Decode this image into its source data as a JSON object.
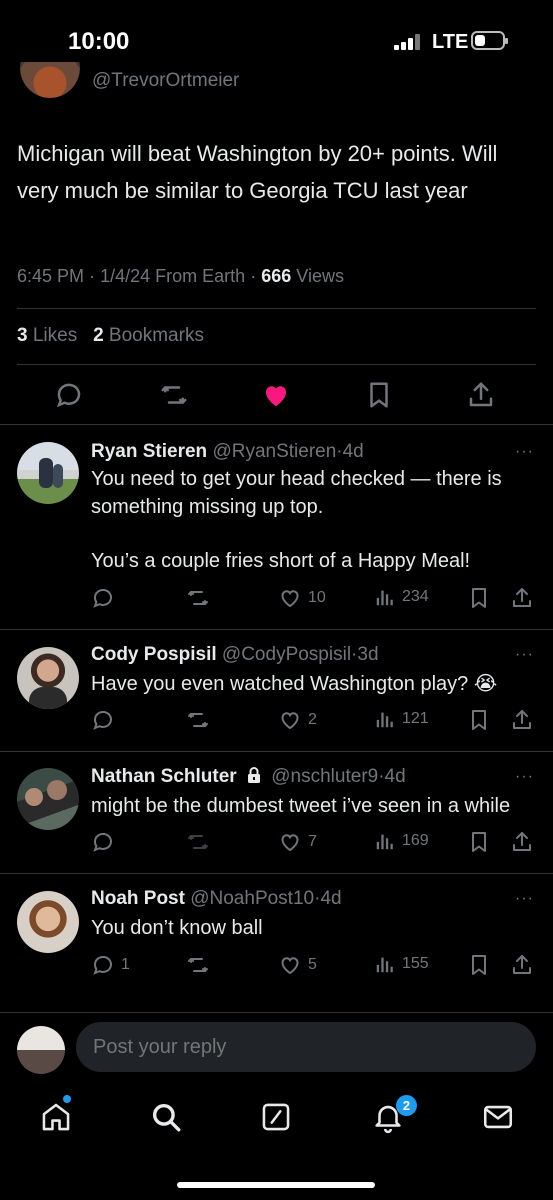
{
  "status_bar": {
    "time": "10:00",
    "network": "LTE"
  },
  "tweet": {
    "author_handle": "@TrevorOrtmeier",
    "text": "Michigan will beat Washington by 20+ points. Will very much be similar to Georgia TCU last year",
    "time": "6:45 PM",
    "date": "1/4/24",
    "source": "From Earth",
    "views_count": "666",
    "views_label": "Views",
    "likes_count": "3",
    "likes_label": "Likes",
    "bookmarks_count": "2",
    "bookmarks_label": "Bookmarks",
    "liked": true,
    "like_color": "#f91880"
  },
  "replies": [
    {
      "name": "Ryan Stieren",
      "handle": "@RyanStieren",
      "age": "4d",
      "text_line1": "You need to get your head checked — there is something missing up top.",
      "text_line2": "You’s a couple fries short of a Happy Meal!",
      "reply_count": "",
      "retweet_count": "",
      "like_count": "10",
      "view_count": "234"
    },
    {
      "name": "Cody Pospisil",
      "handle": "@CodyPospisil",
      "age": "3d",
      "text": "Have you even watched Washington play? 😭",
      "reply_count": "",
      "like_count": "2",
      "view_count": "121"
    },
    {
      "name": "Nathan Schluter",
      "handle": "@nschluter9",
      "age": "4d",
      "protected": true,
      "text": "might be the dumbest tweet i’ve seen in a while",
      "reply_count": "",
      "like_count": "7",
      "view_count": "169"
    },
    {
      "name": "Noah Post",
      "handle": "@NoahPost10",
      "age": "4d",
      "text": "You don’t know ball",
      "reply_count": "1",
      "like_count": "5",
      "view_count": "155"
    }
  ],
  "compose": {
    "placeholder": "Post your reply"
  },
  "tabbar": {
    "items": [
      "home-icon",
      "search-icon",
      "grok-icon",
      "notifications-icon",
      "messages-icon"
    ],
    "notifications_badge": "2",
    "accent": "#1d9bf0"
  },
  "icons": {
    "more": "···",
    "separator": "·"
  }
}
